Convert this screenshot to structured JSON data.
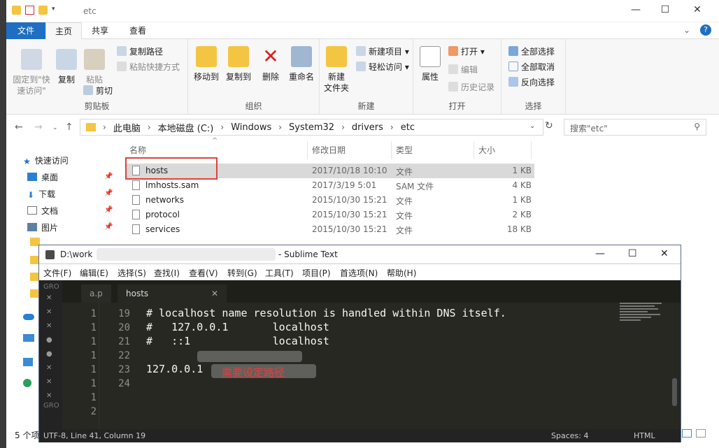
{
  "explorer": {
    "window_title": "etc",
    "ribbon_tabs": [
      "文件",
      "主页",
      "共享",
      "查看"
    ],
    "clipboard": {
      "pin": "固定到\"快速访问\"",
      "copy": "复制",
      "paste": "粘贴",
      "copy_path": "复制路径",
      "paste_shortcut": "粘贴快捷方式",
      "cut": "剪切",
      "label": "剪贴板"
    },
    "organize": {
      "move_to": "移动到",
      "copy_to": "复制到",
      "delete": "删除",
      "rename": "重命名",
      "label": "组织"
    },
    "new": {
      "new_folder": "新建\n文件夹",
      "new_item": "新建项目",
      "easy_access": "轻松访问",
      "label": "新建"
    },
    "open": {
      "properties": "属性",
      "open": "打开",
      "edit": "编辑",
      "history": "历史记录",
      "label": "打开"
    },
    "select": {
      "select_all": "全部选择",
      "select_none": "全部取消",
      "invert": "反向选择",
      "label": "选择"
    },
    "breadcrumb": [
      "此电脑",
      "本地磁盘 (C:)",
      "Windows",
      "System32",
      "drivers",
      "etc"
    ],
    "search_placeholder": "搜索\"etc\"",
    "columns": {
      "name": "名称",
      "modified": "修改日期",
      "type": "类型",
      "size": "大小"
    },
    "files": [
      {
        "name": "hosts",
        "modified": "2017/10/18 10:10",
        "type": "文件",
        "size": "1 KB"
      },
      {
        "name": "lmhosts.sam",
        "modified": "2017/3/19 5:01",
        "type": "SAM 文件",
        "size": "4 KB"
      },
      {
        "name": "networks",
        "modified": "2015/10/30 15:21",
        "type": "文件",
        "size": "1 KB"
      },
      {
        "name": "protocol",
        "modified": "2015/10/30 15:21",
        "type": "文件",
        "size": "2 KB"
      },
      {
        "name": "services",
        "modified": "2015/10/30 15:21",
        "type": "文件",
        "size": "18 KB"
      }
    ],
    "nav": [
      {
        "label": "快速访问"
      },
      {
        "label": "桌面"
      },
      {
        "label": "下载"
      },
      {
        "label": "文档"
      },
      {
        "label": "图片"
      }
    ],
    "status": "5 个项"
  },
  "sublime": {
    "title_left": "D:\\work",
    "title_right": "- Sublime Text",
    "menu": [
      "文件(F)",
      "编辑(E)",
      "选择(S)",
      "查找(I)",
      "查看(V)",
      "转到(G)",
      "工具(T)",
      "项目(P)",
      "首选项(N)",
      "帮助(H)"
    ],
    "tabs": [
      "a.p",
      "hosts"
    ],
    "lines": [
      {
        "n": "19",
        "text": "# localhost name resolution is handled within DNS itself."
      },
      {
        "n": "20",
        "text": "#   127.0.0.1       localhost"
      },
      {
        "n": "21",
        "text": "#   ::1             localhost"
      },
      {
        "n": "22",
        "text": ""
      },
      {
        "n": "23",
        "text": "127.0.0.1"
      },
      {
        "n": "24",
        "text": ""
      }
    ],
    "annotation": "需要设定路径",
    "side_numbers": [
      "1",
      "1",
      "1",
      "1",
      "1",
      "1",
      "1",
      "2"
    ],
    "status_left": "UTF-8, Line 41, Column 19",
    "status_spaces": "Spaces: 4",
    "status_syntax": "HTML"
  }
}
